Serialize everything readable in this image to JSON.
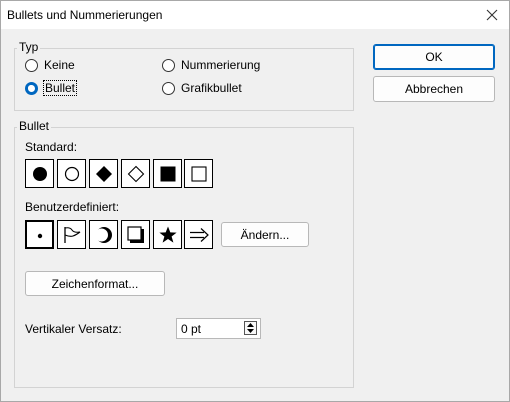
{
  "window": {
    "title": "Bullets und Nummerierungen"
  },
  "typ_group": {
    "label": "Typ",
    "options": [
      {
        "label": "Keine",
        "checked": false
      },
      {
        "label": "Nummerierung",
        "checked": false
      },
      {
        "label": "Bullet",
        "checked": true
      },
      {
        "label": "Grafikbullet",
        "checked": false
      }
    ]
  },
  "bullet_group": {
    "label": "Bullet",
    "standard_label": "Standard:",
    "standard_symbols": [
      "filled-circle-icon",
      "hollow-circle-icon",
      "filled-diamond-icon",
      "hollow-diamond-icon",
      "filled-square-icon",
      "hollow-square-icon"
    ],
    "custom_label": "Benutzerdefiniert:",
    "custom_symbols": [
      "small-dot-icon",
      "flag-icon",
      "crescent-icon",
      "shadowed-square-icon",
      "star-icon",
      "right-double-arrow-icon"
    ],
    "change_button": "Ändern...",
    "char_format_button": "Zeichenformat...",
    "offset_label": "Vertikaler Versatz:",
    "offset_value": "0 pt"
  },
  "buttons": {
    "ok": "OK",
    "cancel": "Abbrechen"
  }
}
